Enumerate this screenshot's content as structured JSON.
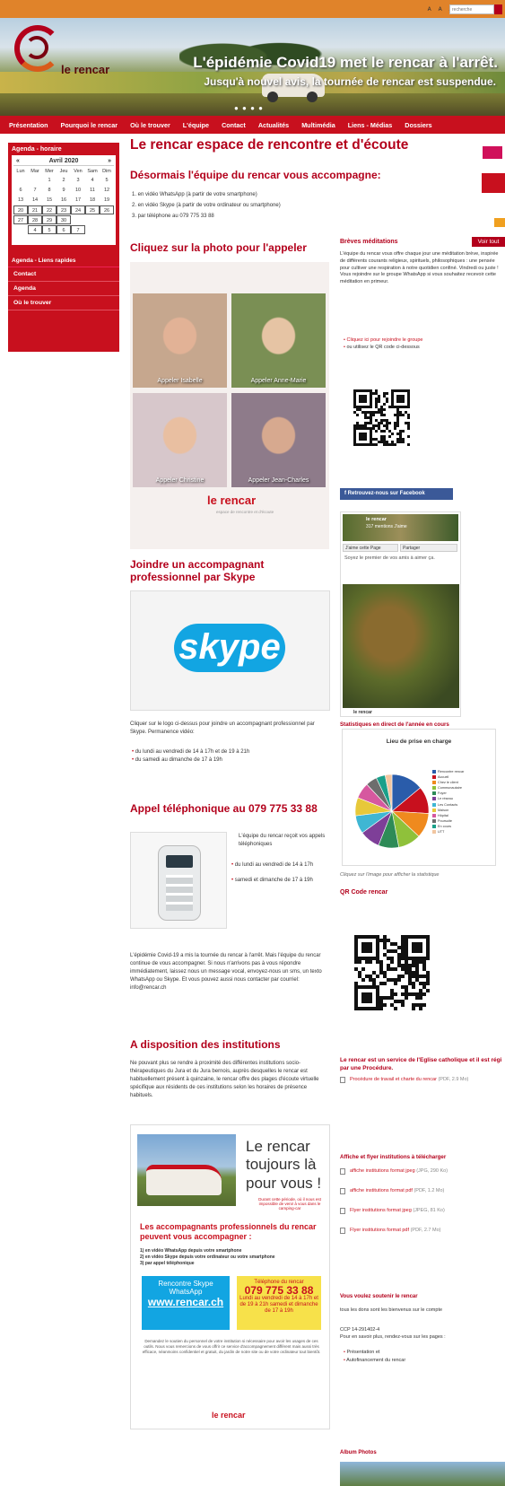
{
  "topbar": {
    "tools": "A A A ⚙",
    "search_placeholder": "recherche"
  },
  "hero": {
    "logo_text": "le rencar",
    "headline": "L'épidémie Covid19 met le rencar à l'arrêt.",
    "subline": "Jusqu'à nouvel avis, la tournée de rencar est suspendue.",
    "dots": "● ● ● ●"
  },
  "nav": [
    "Présentation",
    "Pourquoi le rencar",
    "Où le trouver",
    "L'équipe",
    "Contact",
    "Actualités",
    "Multimédia",
    "Liens - Médias",
    "Dossiers"
  ],
  "sidebar": {
    "agenda_title": "Agenda - horaire",
    "month": "Avril 2020",
    "prev": "«",
    "next": "»",
    "dow": [
      "Lun",
      "Mar",
      "Mer",
      "Jeu",
      "Ven",
      "Sam",
      "Dim"
    ],
    "days": [
      "",
      "",
      "1",
      "2",
      "3",
      "4",
      "5",
      "6",
      "7",
      "8",
      "9",
      "10",
      "11",
      "12",
      "13",
      "14",
      "15",
      "16",
      "17",
      "18",
      "19",
      "20",
      "21",
      "22",
      "23",
      "24",
      "25",
      "26",
      "27",
      "28",
      "29",
      "30",
      "",
      "",
      "",
      "",
      "4",
      "5",
      "6",
      "7",
      "",
      ""
    ],
    "quick_title": "Agenda - Liens rapides",
    "links": [
      "Contact",
      "Agenda",
      "Où le trouver"
    ]
  },
  "main": {
    "title": "Le rencar espace de rencontre et d'écoute",
    "subtitle": "Désormais l'équipe du rencar vous accompagne:",
    "options": [
      "1. en vidéo WhatsApp (à partir de votre smartphone)",
      "2. en vidéo Skype (à partir de votre ordinateur ou smartphone)",
      "3. par téléphone au 079 775 33 88"
    ],
    "photo_heading": "Cliquez sur la photo pour l'appeler",
    "photos": [
      {
        "cap": "Appeler Isabelle",
        "bg": "#c6a78e",
        "face": "#e2b296"
      },
      {
        "cap": "Appeler Anne-Marie",
        "bg": "#7a8f54",
        "face": "#e6c4a4"
      },
      {
        "cap": "Appeler Christine",
        "bg": "#d7c7cb",
        "face": "#e9bfa1"
      },
      {
        "cap": "Appeler Jean-Charles",
        "bg": "#8e7b8a",
        "face": "#d7a98f"
      }
    ],
    "photo_logo": "le rencar",
    "photo_logo_sub": "espace de rencontre et d'écoute",
    "skype_heading": "Joindre un accompagnant professionnel par Skype",
    "skype_logo": "skype",
    "skype_text": "Cliquer sur le logo ci-dessus pour joindre un accompagnant professionnel par Skype. Permanence vidéo:",
    "skype_hours": [
      "du lundi au vendredi de 14 à 17h et de 19 à 21h",
      "du samedi au dimanche de 17 à 19h"
    ],
    "phone_heading": "Appel téléphonique au 079 775 33 88",
    "phone_intro": "L'équipe du rencar reçoit vos appels téléphoniques",
    "phone_hours": [
      "du lundi au vendredi de 14 à 17h",
      "samedi et dimanche de 17 à 19h"
    ],
    "phone_text": "L'épidémie Covid-19 a mis la tournée du rencar à l'arrêt. Mais l'équipe du rencar continue de vous accompagner. Si nous n'arrivons pas à vous répondre immédiatement, laissez nous un message vocal, envoyez-nous un sms, un texto WhatsApp ou Skype. Et vous pouvez aussi nous contacter par courriel: info@rencar.ch",
    "inst_heading": "A disposition des institutions",
    "inst_text": "Ne pouvant plus se rendre à proximité des différentes institutions socio-thérapeutiques du Jura et du Jura bernois, auprès desquelles le rencar est habituellement présent à quinzaine, le rencar offre des plages d'écoute virtuelle spécifique aux résidents de ces institutions selon les horaires de présence habituels.",
    "poster": {
      "big1": "Le rencar",
      "big2": "toujours là",
      "big3": "pour vous !",
      "sub": "Durant cette période, où il nous est impossible de venir à vous dans le camping-car",
      "red": "Les accompagnants professionnels du rencar peuvent vous accompagner :",
      "list": [
        "1) en vidéo WhatsApp depuis votre smartphone",
        "2) en vidéo Skype depuis votre ordinateur ou votre smartphone",
        "3) par appel téléphonique"
      ],
      "box1": "Rencontre Skype WhatsApp",
      "box1_url": "www.rencar.ch",
      "box2_title": "Téléphone du rencar",
      "box2_num": "079 775 33 88",
      "box2_hours": "Lundi au vendredi de 14 à 17h et de 19 à 21h samedi et dimanche de 17 à 19h",
      "fine": "Demandez le soutien du personnel de votre institution si nécessaire pour avoir les usages de ces outils. Nous vous remercions de vous offrir ce service d'accompagnement différent mais aussi très efficace, néanmoins confidentiel et gratuit, du jardin de notre site ou de votre ordinateur tout bientôt.",
      "logo": "le rencar"
    }
  },
  "right": {
    "meditations_title": "Brèves méditations",
    "voir_tout": "Voir tout",
    "meditations_text": "L'équipe du rencar vous offre chaque jour une méditation brève, inspirée de différents courants religieux, spirituels, philosophiques : une pensée pour cultiver une respiration à notre quotidien confiné. Vindredi ou juste ! Vous rejoindre sur le groupe WhatsApp si vous souhaitez recevoir cette méditation en primeur.",
    "med_links": [
      "Cliquez ici pour rejoindre le groupe",
      "ou utilisez le QR code ci-dessous"
    ],
    "fb_button": "f  Retrouvez-nous sur Facebook",
    "fb_page": "le rencar",
    "fb_likes": "317 mentions J'aime",
    "fb_like_btn": "J'aime cette Page",
    "fb_share_btn": "Partager",
    "fb_post": "Soyez le premier de vos amis à aimer ça.",
    "fb_footer": "le rencar",
    "stats_title": "Statistiques en direct de l'année en cours",
    "pie_title": "Lieu de prise en charge",
    "pie_caption": "Cliquez sur l'image pour afficher la statistique",
    "qr_title": "QR Code rencar",
    "service_title": "Le rencar est un service de l'Eglise catholique et il est régi par une Procédure.",
    "service_link": "Procédure de travail et charte du rencar",
    "service_size": "(PDF, 2.9 Mo)",
    "affiche_title": "Affiche et flyer institutions à télécharger",
    "affiche_links": [
      {
        "t": "affiche institutions format jpeg",
        "s": "(JPG, 290 Ko)"
      },
      {
        "t": "affiche institutions format pdf",
        "s": "(PDF, 1.2 Mo)"
      },
      {
        "t": "Flyer institutions format jpeg",
        "s": "(JPEG, 81 Ko)"
      },
      {
        "t": "Flyer institutions format pdf",
        "s": "(PDF, 2.7 Mo)"
      }
    ],
    "support_title": "Vous voulez soutenir le rencar",
    "support_text": "tous les dons sont les bienvenus sur le compte",
    "ccp": "CCP 14-291402-4",
    "support_more": "Pour en savoir plus, rendez-vous sur les pages :",
    "support_links": [
      "Présentation et",
      "Autofinancement du rencar"
    ],
    "album_title": "Album Photos"
  },
  "chart_data": {
    "type": "pie",
    "title": "Lieu de prise en charge",
    "categories": [
      "Rencontre rencar",
      "Accueil",
      "Chez le client",
      "Communautaire",
      "Foyer",
      "Le réseau",
      "Les Contacts",
      "Maison",
      "Hôpital",
      "Poursuite",
      "En cours",
      "UTT"
    ],
    "values": [
      14,
      12,
      11,
      10,
      9,
      9,
      8,
      8,
      7,
      5,
      4,
      3
    ],
    "colors": [
      "#2a5caa",
      "#c8101e",
      "#ef8a1e",
      "#8fc13a",
      "#2e8b57",
      "#7e3f98",
      "#3fb6d3",
      "#e7c83a",
      "#d6589f",
      "#6d6d6d",
      "#1aa08a",
      "#f2c6a0"
    ]
  }
}
